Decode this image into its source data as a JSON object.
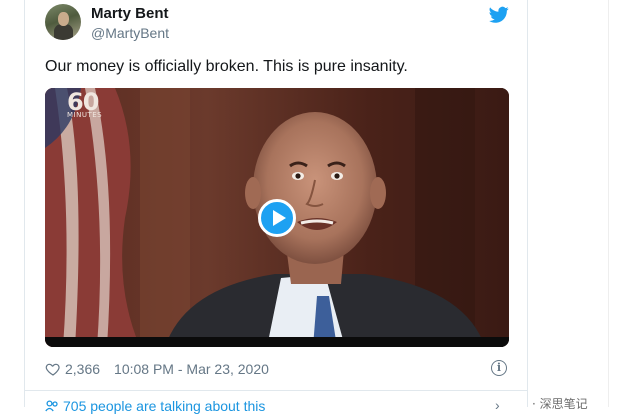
{
  "tweet": {
    "author_name": "Marty Bent",
    "author_handle": "@MartyBent",
    "text": "Our money is officially broken. This is pure insanity.",
    "video": {
      "logo_number": "60",
      "logo_word": "MINUTES"
    },
    "likes": "2,366",
    "timestamp": "10:08 PM - Mar 23, 2020",
    "conversation": "705 people are talking about this"
  },
  "icons": {
    "brand": "twitter-bird-icon",
    "play": "play-icon",
    "like": "heart-icon",
    "info": "info-icon",
    "people": "people-icon",
    "chevron": "chevron-right-icon"
  },
  "colors": {
    "accent": "#1da1f2",
    "link": "#1b95e0",
    "muted": "#657786",
    "text": "#14171a"
  },
  "watermark": {
    "text": "· 深思笔记"
  }
}
